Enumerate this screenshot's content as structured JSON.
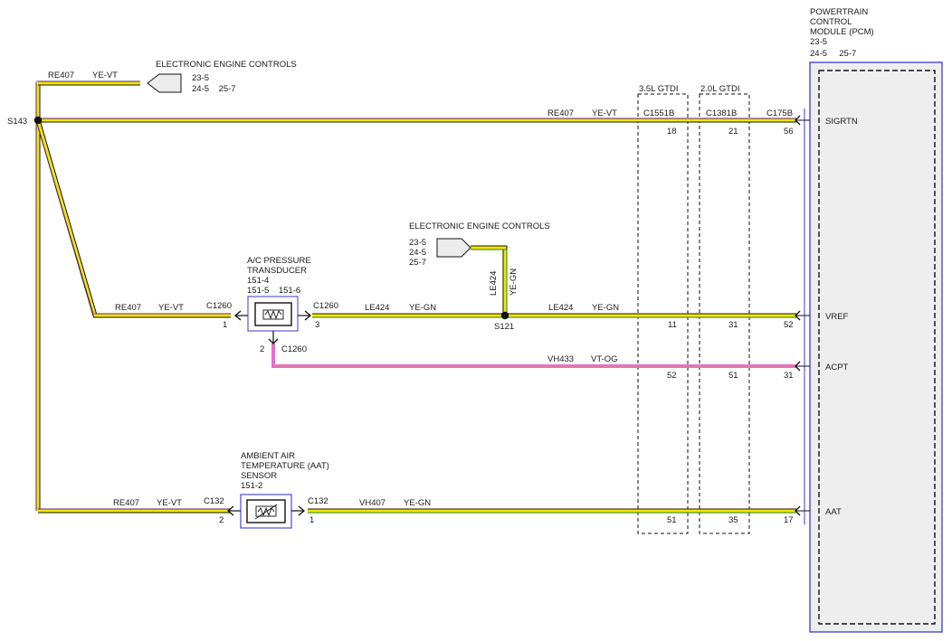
{
  "pcm": {
    "title_lines": [
      "POWERTRAIN",
      "CONTROL",
      "MODULE (PCM)",
      "23-5"
    ],
    "refs": "24-5     25-7",
    "connector": "C175B",
    "pins": [
      {
        "name": "SIGRTN",
        "pin": "56"
      },
      {
        "name": "VREF",
        "pin": "52"
      },
      {
        "name": "ACPT",
        "pin": "31"
      },
      {
        "name": "AAT",
        "pin": "17"
      }
    ]
  },
  "variants": [
    {
      "label": "3.5L GTDI",
      "connector": "C1551B",
      "pins": [
        "18",
        "11",
        "52",
        "51"
      ]
    },
    {
      "label": "2.0L GTDI",
      "connector": "C1381B",
      "pins": [
        "21",
        "31",
        "51",
        "35"
      ]
    }
  ],
  "eec_top": {
    "title": "ELECTRONIC ENGINE CONTROLS",
    "refs": [
      "23-5",
      "24-5    25-7"
    ]
  },
  "eec_mid": {
    "title": "ELECTRONIC ENGINE CONTROLS",
    "refs": [
      "23-5",
      "24-5",
      "25-7"
    ]
  },
  "splices": {
    "s143": "S143",
    "s121": "S121"
  },
  "wires": {
    "re407_top": {
      "circuit": "RE407",
      "color": "YE-VT"
    },
    "re407_sigrtn": {
      "circuit": "RE407",
      "color": "YE-VT"
    },
    "re407_ac": {
      "circuit": "RE407",
      "color": "YE-VT"
    },
    "le424_ac": {
      "circuit": "LE424",
      "color": "YE-GN"
    },
    "le424_pcm": {
      "circuit": "LE424",
      "color": "YE-GN"
    },
    "le424_vert": {
      "circuit": "LE424",
      "color": "YE-GN"
    },
    "vh433": {
      "circuit": "VH433",
      "color": "VT-OG"
    },
    "re407_aat": {
      "circuit": "RE407",
      "color": "YE-VT"
    },
    "vh407": {
      "circuit": "VH407",
      "color": "YE-GN"
    }
  },
  "ac_sensor": {
    "title_lines": [
      "A/C PRESSURE",
      "TRANSDUCER",
      "151-4",
      "151-5    151-6"
    ],
    "conn_left": "C1260",
    "pin_left": "1",
    "conn_right": "C1260",
    "pin_right": "3",
    "pin_bottom": "2",
    "conn_bottom": "C1260"
  },
  "aat_sensor": {
    "title_lines": [
      "AMBIENT AIR",
      "TEMPERATURE (AAT)",
      "SENSOR",
      "151-2"
    ],
    "conn_left": "C132",
    "pin_left": "2",
    "conn_right": "C132",
    "pin_right": "1"
  },
  "colors": {
    "yellow": "#f5e600",
    "green": "#4a9a24",
    "violet": "#6a2aa8",
    "pink": "#e56fd2",
    "module_blue": "#3a3ad0",
    "module_fill": "#eeeeee"
  }
}
